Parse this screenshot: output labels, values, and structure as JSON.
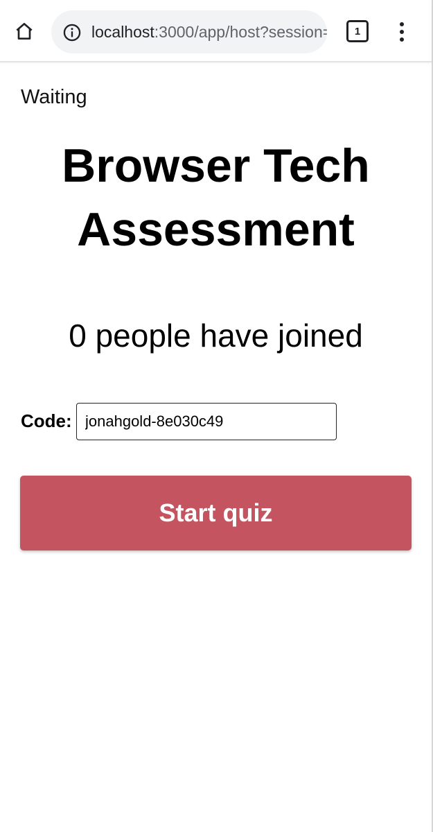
{
  "browser": {
    "url_host": "localhost",
    "url_rest": ":3000/app/host?session=",
    "tab_count": "1",
    "icons": {
      "home": "home-icon",
      "info": "info-icon",
      "tabs": "tab-switcher-icon",
      "menu": "more-vert-icon"
    }
  },
  "page": {
    "status": "Waiting",
    "title": "Browser Tech Assessment",
    "joined_text": "0 people have joined",
    "code_label": "Code:",
    "code_value": "jonahgold-8e030c49",
    "start_label": "Start quiz"
  },
  "colors": {
    "start_button": "#c45560",
    "start_text": "#ffffff"
  }
}
